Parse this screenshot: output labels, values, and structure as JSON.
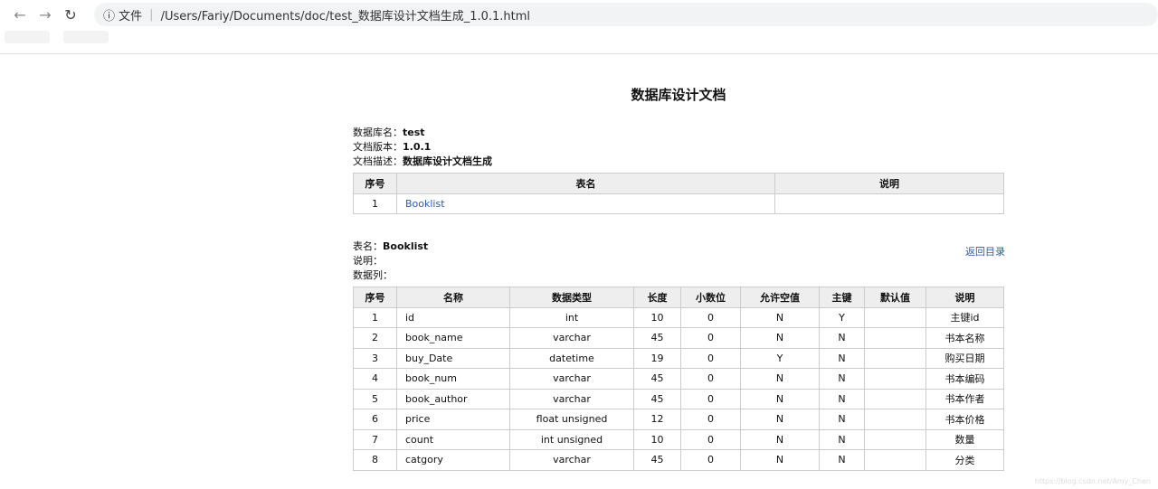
{
  "browser": {
    "info_label": "文件",
    "url": "/Users/Fariy/Documents/doc/test_数据库设计文档生成_1.0.1.html"
  },
  "title": "数据库设计文档",
  "meta": {
    "db_label": "数据库名：",
    "db": "test",
    "ver_label": "文档版本：",
    "ver": "1.0.1",
    "desc_label": "文档描述：",
    "desc": "数据库设计文档生成"
  },
  "index_table": {
    "headers": [
      "序号",
      "表名",
      "说明"
    ],
    "rows": [
      [
        "1",
        "Booklist",
        ""
      ]
    ]
  },
  "table_info": {
    "name_label": "表名：",
    "name": "Booklist",
    "desc_label": "说明：",
    "cols_label": "数据列：",
    "back_link": "返回目录"
  },
  "columns_table": {
    "headers": [
      "序号",
      "名称",
      "数据类型",
      "长度",
      "小数位",
      "允许空值",
      "主键",
      "默认值",
      "说明"
    ],
    "rows": [
      [
        "1",
        "id",
        "int",
        "10",
        "0",
        "N",
        "Y",
        "",
        "主键id"
      ],
      [
        "2",
        "book_name",
        "varchar",
        "45",
        "0",
        "N",
        "N",
        "",
        "书本名称"
      ],
      [
        "3",
        "buy_Date",
        "datetime",
        "19",
        "0",
        "Y",
        "N",
        "",
        "购买日期"
      ],
      [
        "4",
        "book_num",
        "varchar",
        "45",
        "0",
        "N",
        "N",
        "",
        "书本编码"
      ],
      [
        "5",
        "book_author",
        "varchar",
        "45",
        "0",
        "N",
        "N",
        "",
        "书本作者"
      ],
      [
        "6",
        "price",
        "float unsigned",
        "12",
        "0",
        "N",
        "N",
        "",
        "书本价格"
      ],
      [
        "7",
        "count",
        "int unsigned",
        "10",
        "0",
        "N",
        "N",
        "",
        "数量"
      ],
      [
        "8",
        "catgory",
        "varchar",
        "45",
        "0",
        "N",
        "N",
        "",
        "分类"
      ]
    ]
  },
  "watermark": "https://blog.csdn.net/Amy_Chen"
}
